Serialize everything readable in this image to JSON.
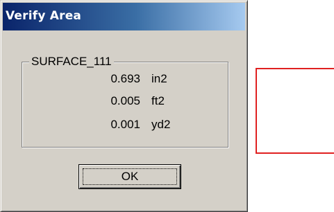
{
  "window": {
    "title": "Verify Area"
  },
  "group": {
    "label": "SURFACE_111",
    "rows": [
      {
        "value": "0.693",
        "unit": "in2"
      },
      {
        "value": "0.005",
        "unit": "ft2"
      },
      {
        "value": "0.001",
        "unit": "yd2"
      }
    ]
  },
  "buttons": {
    "ok_label": "OK"
  },
  "colors": {
    "titlebar_start": "#0a246a",
    "titlebar_end": "#a6caf0",
    "dialog_face": "#d4d0c8",
    "outline_red": "#e02020"
  }
}
